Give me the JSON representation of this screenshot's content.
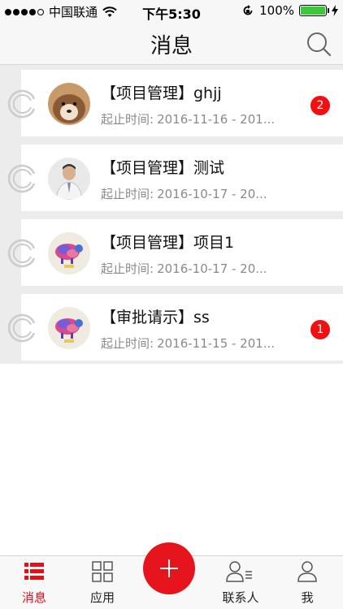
{
  "status_bar": {
    "carrier": "中国联通",
    "time": "下午5:30",
    "battery": "100%"
  },
  "nav": {
    "title": "消息"
  },
  "messages": [
    {
      "title": "【项目管理】ghjj",
      "sub_label": "起止时间:",
      "sub_value": "2016-11-16 - 201...",
      "badge": "2"
    },
    {
      "title": "【项目管理】测试",
      "sub_label": "起止时间:",
      "sub_value": "2016-10-17 - 20...",
      "badge": ""
    },
    {
      "title": "【项目管理】项目1",
      "sub_label": "起止时间:",
      "sub_value": "2016-10-17 - 20...",
      "badge": ""
    },
    {
      "title": "【审批请示】ss",
      "sub_label": "起止时间:",
      "sub_value": "2016-11-15 - 201...",
      "badge": "1"
    }
  ],
  "tabs": [
    {
      "label": "消息",
      "icon": "list-icon",
      "active": true
    },
    {
      "label": "应用",
      "icon": "grid-icon",
      "active": false
    },
    {
      "label": "",
      "icon": "plus-icon",
      "active": false
    },
    {
      "label": "联系人",
      "icon": "contacts-icon",
      "active": false
    },
    {
      "label": "我",
      "icon": "person-icon",
      "active": false
    }
  ],
  "colors": {
    "accent": "#e6141c",
    "badge": "#f10f0f",
    "list_bg": "#ececec",
    "battery": "#3cc83c"
  }
}
